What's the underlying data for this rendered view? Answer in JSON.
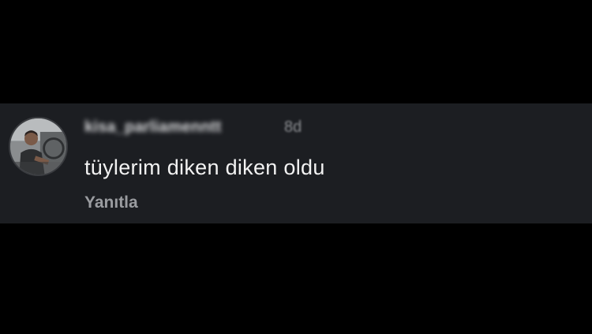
{
  "comment": {
    "username": "kisa_parliamenntt",
    "timestamp": "8d",
    "text": "tüylerim diken diken oldu",
    "reply_label": "Yanıtla",
    "avatar_icon": "user-avatar-photo"
  },
  "colors": {
    "page_background": "#000000",
    "card_background": "#1c1e22",
    "text_primary": "#f2f2f2",
    "text_secondary": "#9a9ca0"
  }
}
